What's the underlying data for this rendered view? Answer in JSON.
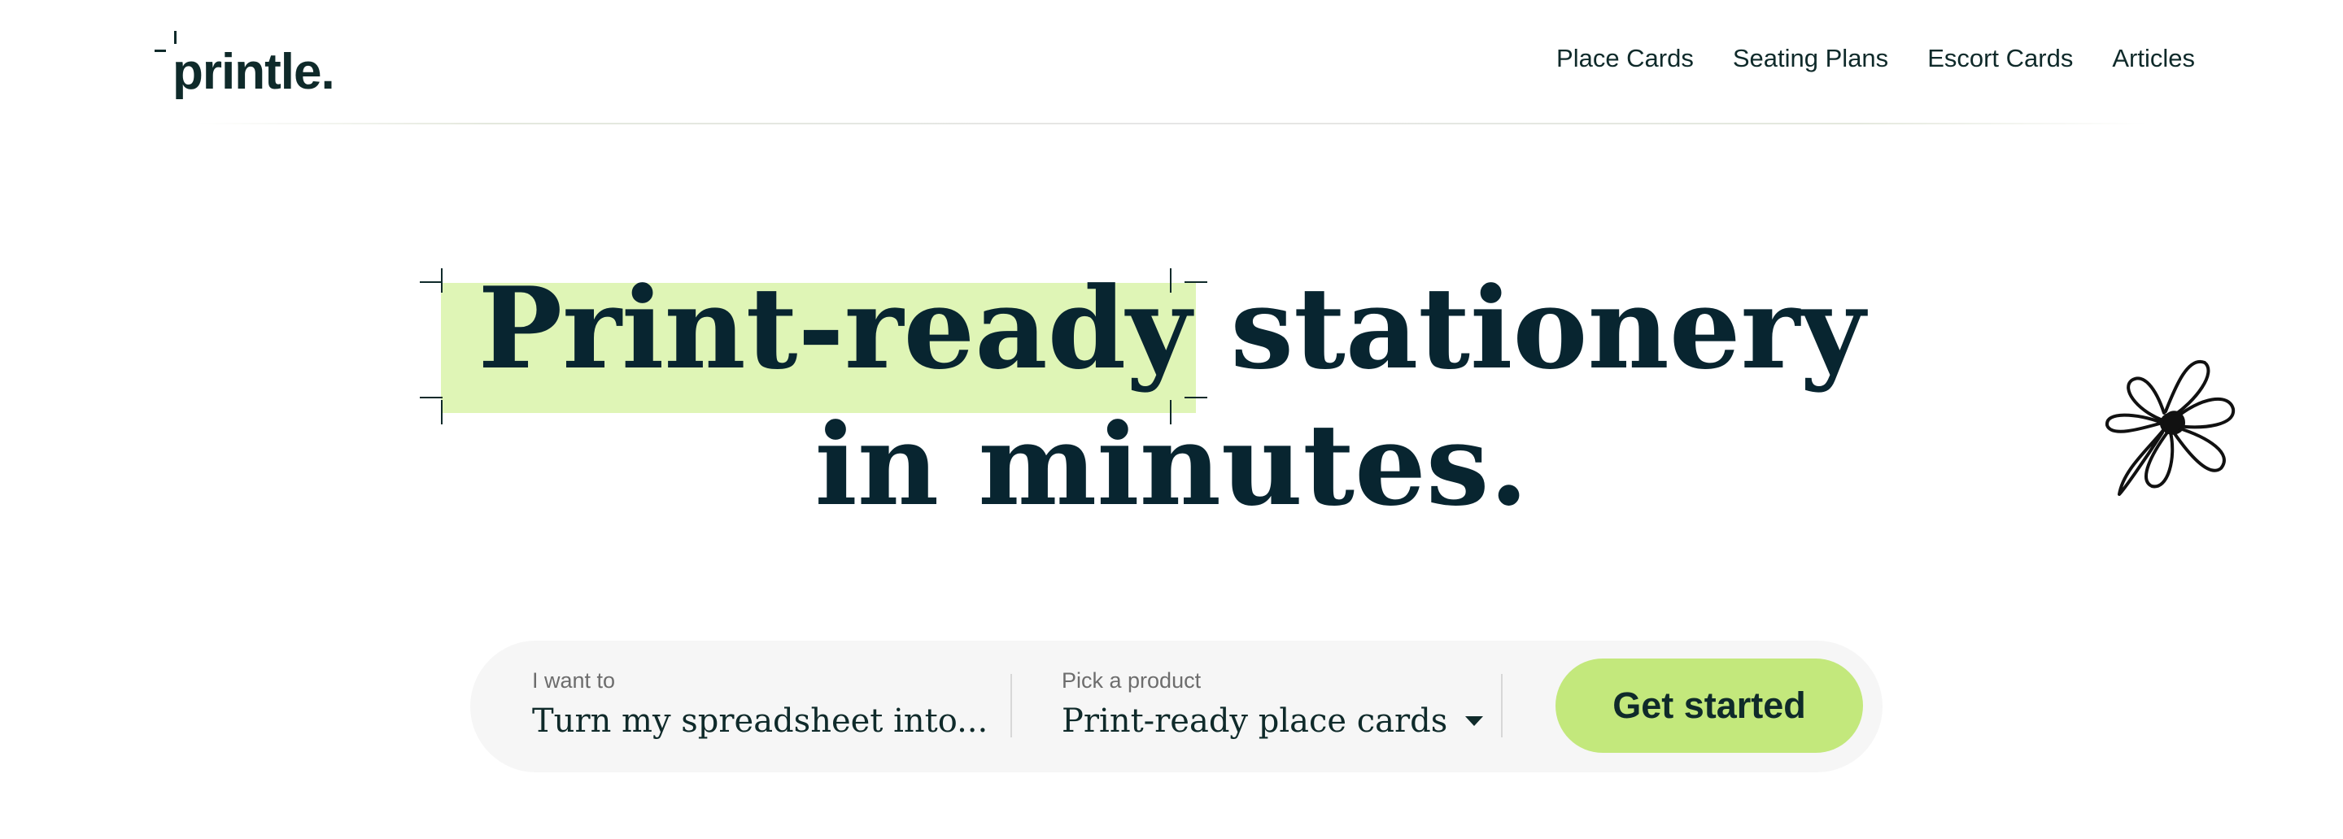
{
  "header": {
    "logo_text": "printle.",
    "nav": [
      {
        "label": "Place Cards"
      },
      {
        "label": "Seating Plans"
      },
      {
        "label": "Escort Cards"
      },
      {
        "label": "Articles"
      }
    ]
  },
  "hero": {
    "highlight": "Print-ready",
    "line1_rest": "stationery",
    "line2": "in minutes."
  },
  "search": {
    "want": {
      "label": "I want to",
      "value": "Turn my spreadsheet into..."
    },
    "product": {
      "label": "Pick a product",
      "value": "Print-ready place cards"
    },
    "cta_label": "Get started"
  },
  "icons": {
    "logo_mark": "crop-mark-icon",
    "caret": "chevron-down-icon",
    "flower": "flower-doodle-icon"
  },
  "colors": {
    "brand_green": "#c3e87c",
    "highlight": "#dff5b6",
    "ink": "#082530",
    "search_bg": "#f6f6f6"
  }
}
